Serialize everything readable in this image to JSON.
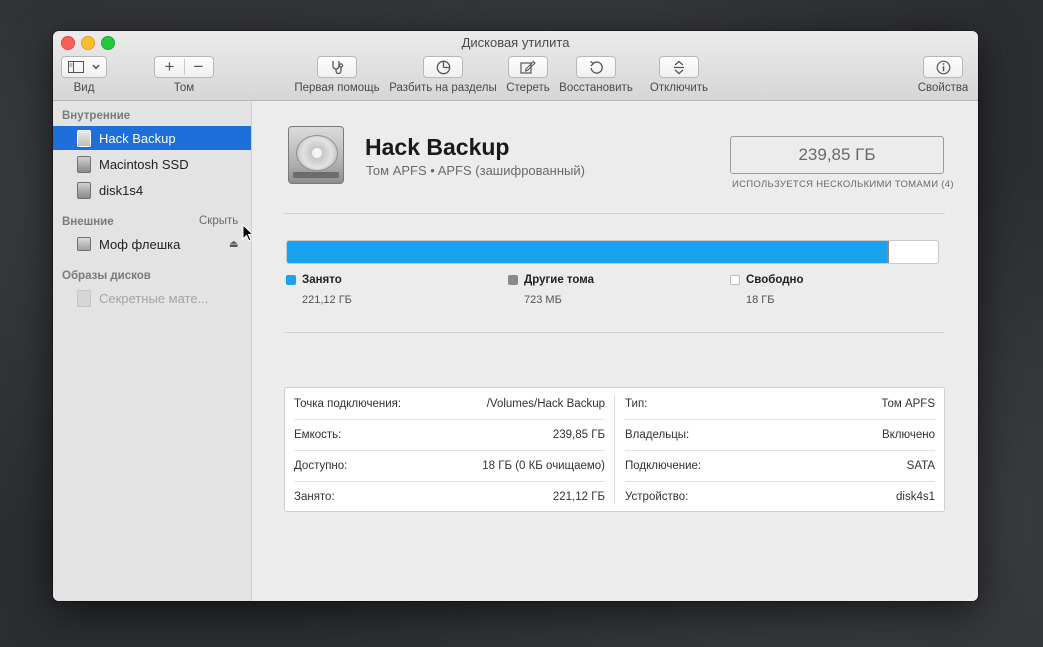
{
  "window": {
    "title": "Дисковая утилита"
  },
  "toolbar": {
    "view_label": "Вид",
    "volume_label": "Том",
    "first_aid_label": "Первая помощь",
    "partition_label": "Разбить на разделы",
    "erase_label": "Стереть",
    "restore_label": "Восстановить",
    "unmount_label": "Отключить",
    "info_label": "Свойства",
    "add_glyph": "+",
    "remove_glyph": "−"
  },
  "sidebar": {
    "internal_header": "Внутренние",
    "external_header": "Внешние",
    "hide_label": "Скрыть",
    "images_header": "Образы дисков",
    "internal_items": [
      {
        "label": "Hack Backup",
        "selected": true
      },
      {
        "label": "Macintosh SSD",
        "selected": false
      },
      {
        "label": "disk1s4",
        "selected": false
      }
    ],
    "external_items": [
      {
        "label": "Моф флешка",
        "eject": "⏏"
      }
    ],
    "image_items": [
      {
        "label": "Секретные мате..."
      }
    ]
  },
  "volume": {
    "name": "Hack Backup",
    "subtitle": "Том APFS • APFS (зашифрованный)",
    "capacity": "239,85 ГБ",
    "capacity_note": "ИСПОЛЬЗУЕТСЯ НЕСКОЛЬКИМИ ТОМАМИ (4)"
  },
  "usage": {
    "used_fraction": 0.922,
    "other_fraction": 0.003,
    "colors": {
      "used": "#1ba2ef",
      "other": "#8a8a8a",
      "free": "#ffffff"
    },
    "legend": [
      {
        "name": "Занято",
        "value": "221,12 ГБ"
      },
      {
        "name": "Другие тома",
        "value": "723 МБ"
      },
      {
        "name": "Свободно",
        "value": "18 ГБ"
      }
    ]
  },
  "info_table": {
    "left": [
      {
        "key": "Точка подключения:",
        "value": "/Volumes/Hack Backup"
      },
      {
        "key": "Емкость:",
        "value": "239,85 ГБ"
      },
      {
        "key": "Доступно:",
        "value": "18 ГБ (0 КБ очищаемо)"
      },
      {
        "key": "Занято:",
        "value": "221,12 ГБ"
      }
    ],
    "right": [
      {
        "key": "Тип:",
        "value": "Том APFS"
      },
      {
        "key": "Владельцы:",
        "value": "Включено"
      },
      {
        "key": "Подключение:",
        "value": "SATA"
      },
      {
        "key": "Устройство:",
        "value": "disk4s1"
      }
    ]
  }
}
